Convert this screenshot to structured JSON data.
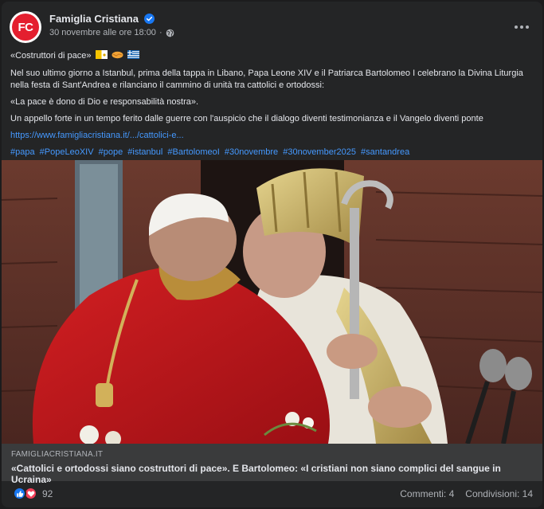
{
  "post": {
    "page_name": "Famiglia Cristiana",
    "avatar_text": "FC",
    "timestamp": "30 novembre alle ore 18:00",
    "meta_separator": "·",
    "line1": "«Costruttori di pace»",
    "paragraph1": "Nel suo ultimo giorno a Istanbul, prima della tappa in Libano, Papa Leone XIV e il Patriarca Bartolomeo I celebrano la Divina Liturgia nella festa di Sant'Andrea e rilanciano il cammino di unità tra cattolici e ortodossi:",
    "quote": "«La pace è dono di Dio e responsabilità nostra».",
    "paragraph2": "Un appello forte in un tempo ferito dalle guerre con l'auspicio che il dialogo diventi testimonianza e il Vangelo diventi ponte",
    "link": "https://www.famigliacristiana.it/.../cattolici-e...",
    "hashtags": [
      "#papa",
      "#PopeLeoXIV",
      "#pope",
      "#istanbul",
      "#BartolomeoI",
      "#30novembre",
      "#30november2025",
      "#santandrea"
    ]
  },
  "preview": {
    "domain": "FAMIGLIACRISTIANA.IT",
    "title": "«Cattolici e ortodossi siano costruttori di pace». E Bartolomeo: «I cristiani non siano complici del sangue in Ucraina»"
  },
  "footer": {
    "reaction_count": "92",
    "comments": "Commenti: 4",
    "shares": "Condivisioni: 14"
  },
  "colors": {
    "background": "#242526",
    "link": "#4599ff",
    "brand": "#e41f2f",
    "like": "#1877f2",
    "love": "#f33e58"
  }
}
